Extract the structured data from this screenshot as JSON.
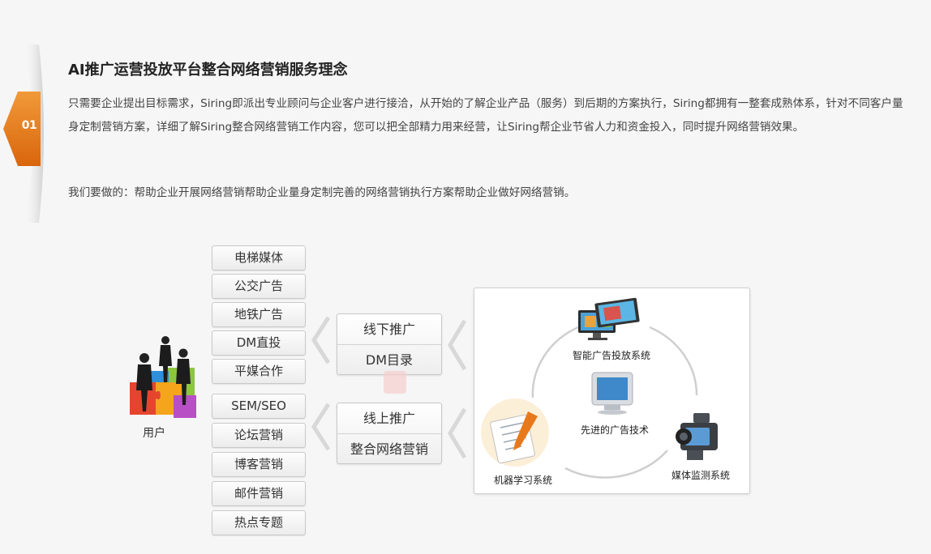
{
  "badge": {
    "number": "01"
  },
  "header": {
    "title": "AI推广运营投放平台整合网络营销服务理念",
    "paragraph1": "只需要企业提出目标需求，Siring即派出专业顾问与企业客户进行接洽，从开始的了解企业产品（服务）到后期的方案执行，Siring都拥有一整套成熟体系，针对不同客户量身定制营销方案，详细了解Siring整合网络营销工作内容，您可以把全部精力用来经营，让Siring帮企业节省人力和资金投入，同时提升网络营销效果。",
    "paragraph2": "我们要做的：帮助企业开展网络营销帮助企业量身定制完善的网络营销执行方案帮助企业做好网络营销。"
  },
  "user": {
    "label": "用户"
  },
  "offline_channels": [
    "电梯媒体",
    "公交广告",
    "地铁广告",
    "DM直投",
    "平媒合作"
  ],
  "online_channels": [
    "SEM/SEO",
    "论坛营销",
    "博客营销",
    "邮件营销",
    "热点专题"
  ],
  "offline_group": {
    "line1": "线下推广",
    "line2": "DM目录"
  },
  "online_group": {
    "line1": "线上推广",
    "line2": "整合网络营销"
  },
  "systems": {
    "top": "智能广告投放系统",
    "center": "先进的广告技术",
    "left": "机器学习系统",
    "right": "媒体监测系统"
  },
  "colors": {
    "accent": "#e8791a",
    "border": "#c9c9c9"
  }
}
